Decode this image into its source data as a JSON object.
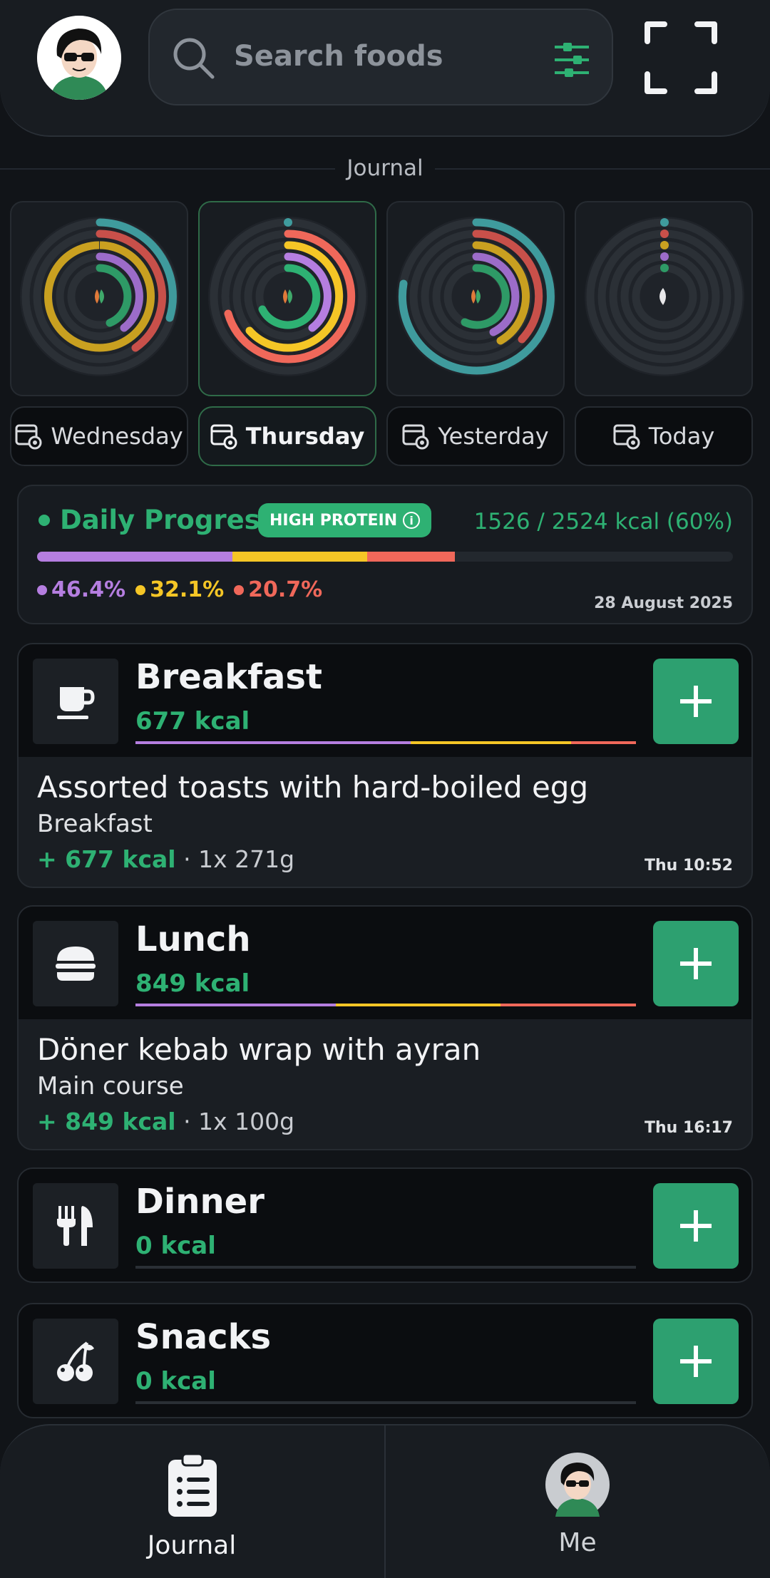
{
  "header": {
    "search_placeholder": "Search foods"
  },
  "journal_title": "Journal",
  "days": [
    {
      "label": "Wednesday",
      "active": false
    },
    {
      "label": "Thursday",
      "active": true
    },
    {
      "label": "Yesterday",
      "active": false
    },
    {
      "label": "Today",
      "active": false
    }
  ],
  "progress": {
    "title": "Daily Progress",
    "badge": "HIGH PROTEIN",
    "kcal_text": "1526 / 2524 kcal (60%)",
    "macros": [
      {
        "value": "46.4%",
        "color": "#b57ee0"
      },
      {
        "value": "32.1%",
        "color": "#f5c626"
      },
      {
        "value": "20.7%",
        "color": "#f0685a"
      }
    ],
    "bar_fraction": 0.6,
    "date": "28 August 2025"
  },
  "meals": [
    {
      "name": "Breakfast",
      "kcal": "677 kcal",
      "entry": {
        "title": "Assorted toasts with hard-boiled egg",
        "category": "Breakfast",
        "kcal": "+ 677 kcal",
        "qty": "· 1x 271g",
        "time": "Thu 10:52"
      }
    },
    {
      "name": "Lunch",
      "kcal": "849 kcal",
      "entry": {
        "title": "Döner kebab wrap with ayran",
        "category": "Main course",
        "kcal": "+ 849 kcal",
        "qty": "· 1x 100g",
        "time": "Thu 16:17"
      }
    },
    {
      "name": "Dinner",
      "kcal": "0 kcal"
    },
    {
      "name": "Snacks",
      "kcal": "0 kcal"
    }
  ],
  "nav": {
    "journal": "Journal",
    "me": "Me"
  },
  "colors": {
    "accent": "#2eb173",
    "protein": "#b57ee0",
    "carbs": "#f5c626",
    "fat": "#f0685a",
    "teal": "#3f9b9d"
  },
  "icons": [
    "search-icon",
    "filter-icon",
    "scan-icon",
    "calendar-eye-icon",
    "info-icon",
    "coffee-cup-icon",
    "burger-icon",
    "fork-knife-icon",
    "cherries-icon",
    "clipboard-list-icon",
    "plus-icon"
  ]
}
